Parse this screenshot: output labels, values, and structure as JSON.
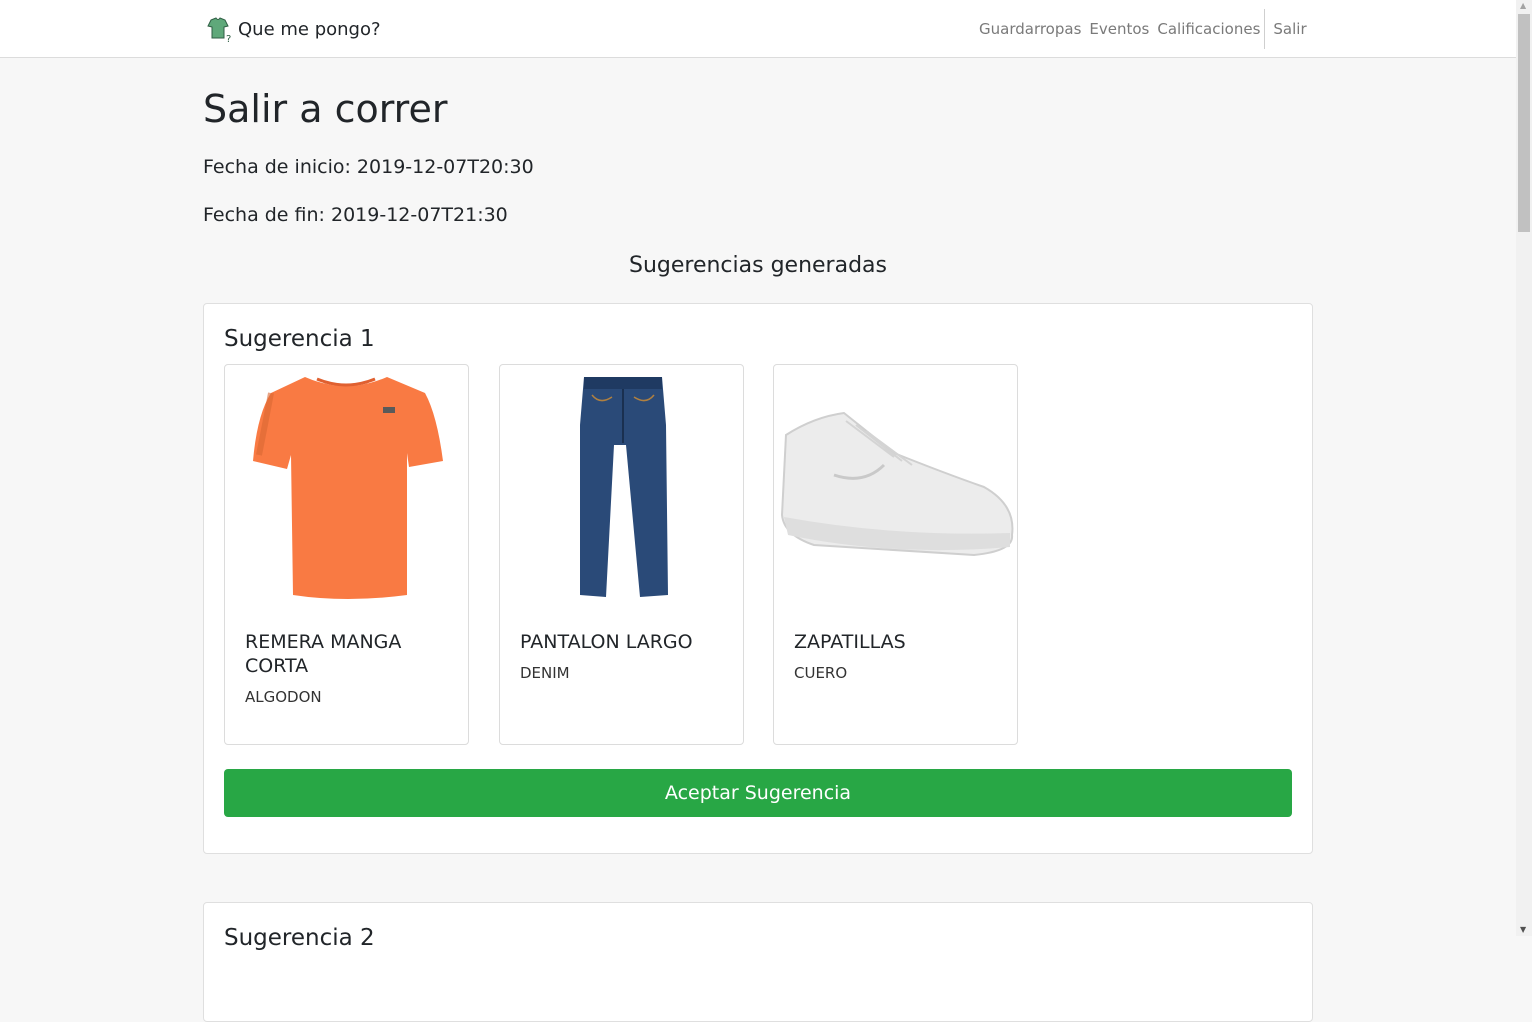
{
  "navbar": {
    "brand": "Que me pongo?",
    "links": [
      "Guardarropas",
      "Eventos",
      "Calificaciones"
    ],
    "logout": "Salir"
  },
  "event": {
    "title": "Salir a correr",
    "start_label": "Fecha de inicio: 2019-12-07T20:30",
    "end_label": "Fecha de fin: 2019-12-07T21:30"
  },
  "suggestions": {
    "heading": "Sugerencias generadas",
    "items": [
      {
        "title": "Sugerencia 1",
        "garments": [
          {
            "name": "REMERA MANGA CORTA",
            "material": "ALGODON",
            "icon": "orange-tshirt-image"
          },
          {
            "name": "PANTALON LARGO",
            "material": "DENIM",
            "icon": "jeans-image"
          },
          {
            "name": "ZAPATILLAS",
            "material": "CUERO",
            "icon": "white-sneaker-image"
          }
        ],
        "accept_label": "Aceptar Sugerencia"
      },
      {
        "title": "Sugerencia 2"
      }
    ]
  },
  "colors": {
    "accept_button": "#28a745",
    "shirt": "#f97a43",
    "jeans": "#2a4a78"
  }
}
